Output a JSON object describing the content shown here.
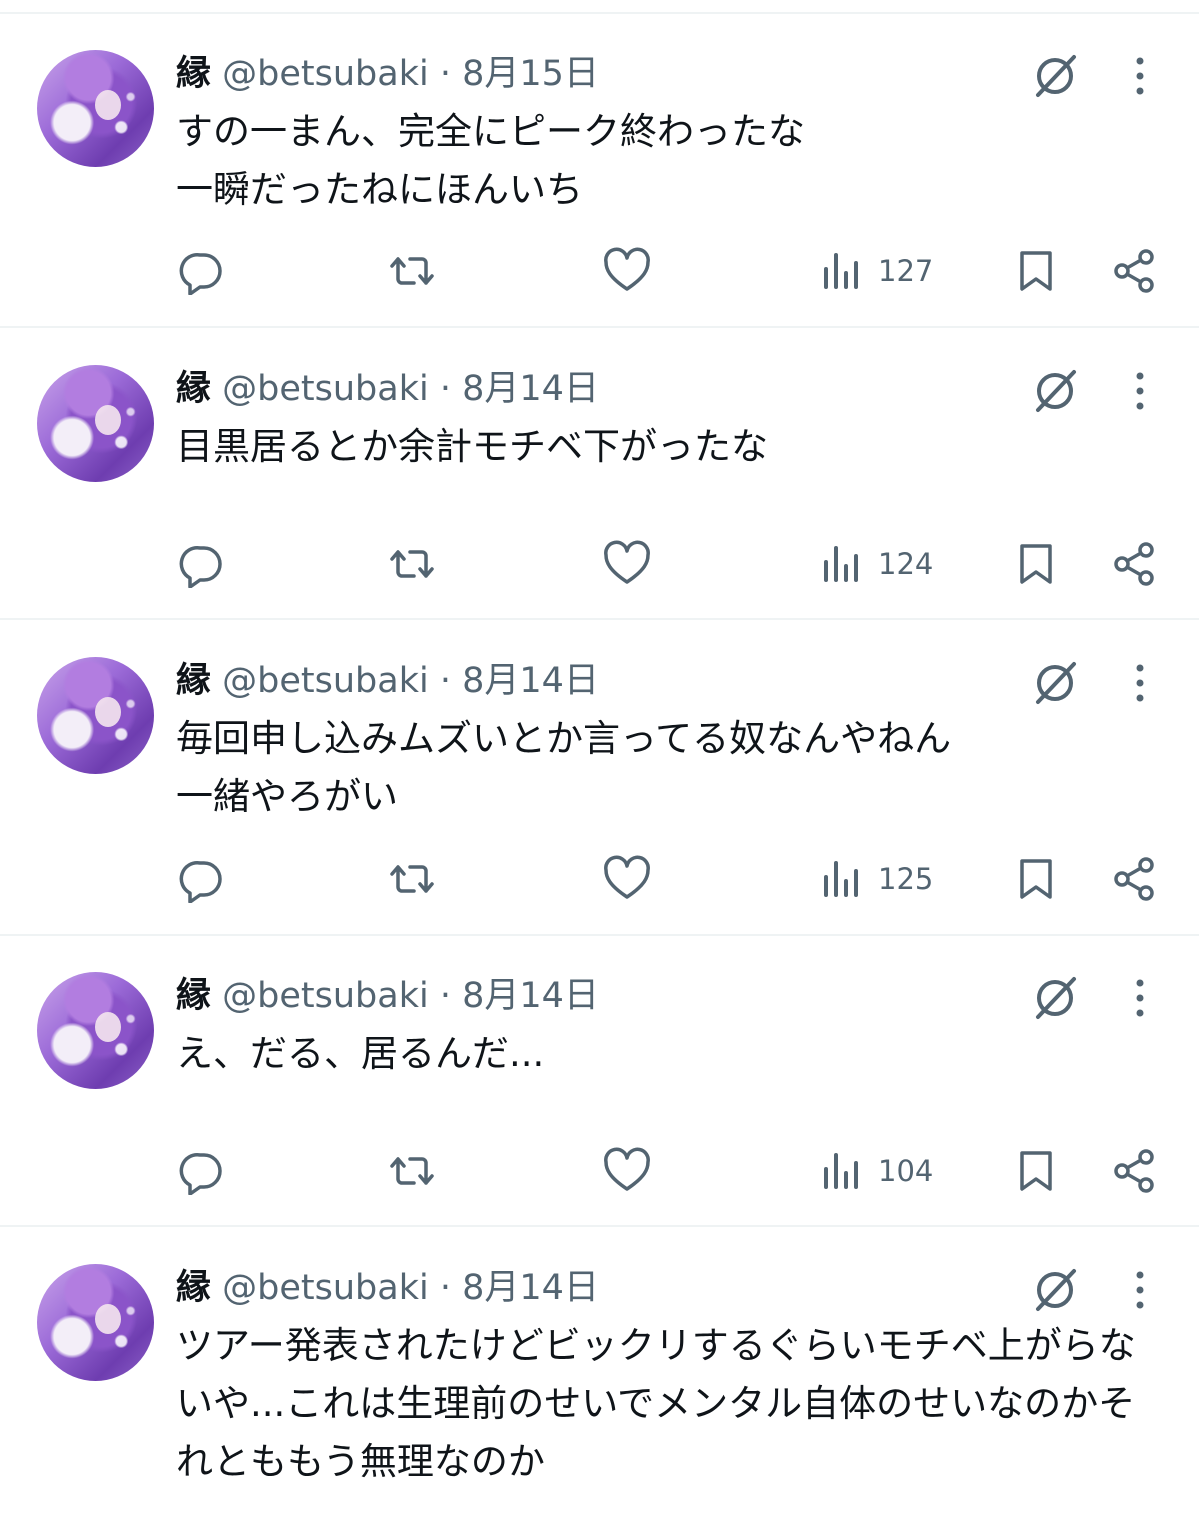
{
  "colors": {
    "text": "#0f1419",
    "secondary": "#536471",
    "divider": "#eff3f4",
    "avatar_accent": "#8b54c9"
  },
  "icons": [
    "grok-icon",
    "more-icon",
    "reply-icon",
    "retweet-icon",
    "like-icon",
    "views-icon",
    "bookmark-icon",
    "share-icon"
  ],
  "tweets": [
    {
      "name": "縁",
      "handle": "@betsubaki",
      "dot": "·",
      "date": "8月15日",
      "text": "すの一まん、完全にピーク終わったな\n一瞬だったねにほんいち",
      "views": "127"
    },
    {
      "name": "縁",
      "handle": "@betsubaki",
      "dot": "·",
      "date": "8月14日",
      "text": "目黒居るとか余計モチベ下がったな",
      "views": "124"
    },
    {
      "name": "縁",
      "handle": "@betsubaki",
      "dot": "·",
      "date": "8月14日",
      "text": "毎回申し込みムズいとか言ってる奴なんやねん\n一緒やろがい",
      "views": "125"
    },
    {
      "name": "縁",
      "handle": "@betsubaki",
      "dot": "·",
      "date": "8月14日",
      "text": "え、だる、居るんだ...",
      "views": "104"
    },
    {
      "name": "縁",
      "handle": "@betsubaki",
      "dot": "·",
      "date": "8月14日",
      "text": "ツアー発表されたけどビックリするぐらいモチベ上がらないや...これは生理前のせいでメンタル自体のせいなのかそれとももう無理なのか",
      "views": ""
    }
  ]
}
